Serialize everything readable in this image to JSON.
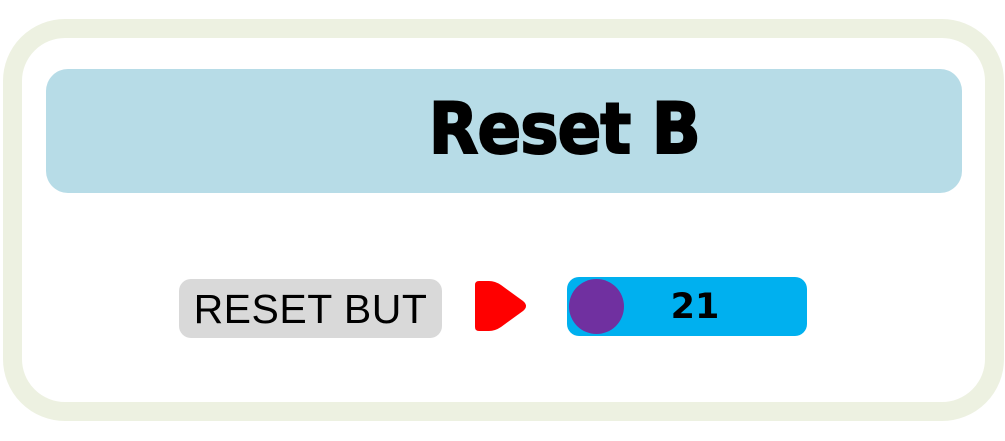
{
  "header": {
    "title": "Reset B"
  },
  "controls": {
    "reset_button_label": "RESET BUT",
    "arrow_icon": "play-arrow-icon",
    "value": "21"
  },
  "colors": {
    "card_border": "#edf1e1",
    "title_bar": "#b7dce7",
    "reset_button": "#d9d9d9",
    "arrow": "#ff0000",
    "value_track": "#00b0ef",
    "knob": "#7030a0"
  }
}
